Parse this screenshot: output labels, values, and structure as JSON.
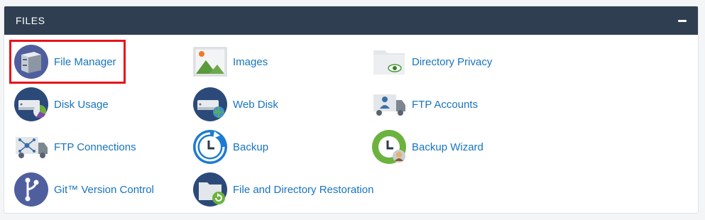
{
  "section": {
    "title": "FILES",
    "collapse_icon": "minus-icon"
  },
  "items": [
    {
      "label": "File Manager",
      "icon": "file-cabinet-icon"
    },
    {
      "label": "Images",
      "icon": "image-landscape-icon"
    },
    {
      "label": "Directory Privacy",
      "icon": "folder-eye-icon"
    },
    {
      "label": "Disk Usage",
      "icon": "disk-pie-icon"
    },
    {
      "label": "Web Disk",
      "icon": "disk-globe-icon"
    },
    {
      "label": "FTP Accounts",
      "icon": "truck-user-icon"
    },
    {
      "label": "FTP Connections",
      "icon": "truck-network-icon"
    },
    {
      "label": "Backup",
      "icon": "backup-clock-icon"
    },
    {
      "label": "Backup Wizard",
      "icon": "backup-wizard-icon"
    },
    {
      "label": "Git™ Version Control",
      "icon": "git-branch-icon"
    },
    {
      "label": "File and Directory Restoration",
      "icon": "folder-restore-icon"
    }
  ],
  "colors": {
    "header_bg": "#2f3f51",
    "link": "#1774c0",
    "highlight": "#e8141b"
  }
}
